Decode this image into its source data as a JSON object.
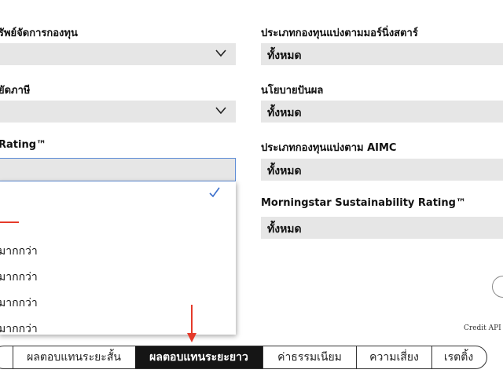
{
  "filters": {
    "left": {
      "fund_company_label": "รัพย์จัดการกองทุน",
      "tax_label": "ยัดภาษี",
      "rating_label": "Rating™"
    },
    "right": {
      "morningstar_category_label": "ประเภทกองทุนแบ่งตามมอร์นิ่งสตาร์",
      "morningstar_category_value": "ทั้งหมด",
      "dividend_policy_label": "นโยบายปันผล",
      "dividend_policy_value": "ทั้งหมด",
      "aimc_category_label": "ประเภทกองทุนแบ่งตาม AIMC",
      "aimc_category_value": "ทั้งหมด",
      "sustainability_label": "Morningstar Sustainability Rating™",
      "sustainability_value": "ทั้งหมด"
    }
  },
  "rating_dropdown": {
    "options": [
      "มากกว่า",
      "มากกว่า",
      "มากกว่า",
      "มากกว่า"
    ],
    "selected_index": 0
  },
  "credit": "Credit API K",
  "tabs": [
    {
      "label": "ผลตอบแทนระยะสั้น",
      "active": false
    },
    {
      "label": "ผลตอบแทนระยะยาว",
      "active": true
    },
    {
      "label": "ค่าธรรมเนียม",
      "active": false
    },
    {
      "label": "ความเสี่ยง",
      "active": false
    },
    {
      "label": "เรตติ้ง",
      "active": false
    }
  ],
  "colors": {
    "accent_red": "#e53a2a",
    "focus_blue": "#5b8bd6",
    "active_tab_bg": "#151515",
    "select_bg": "#e6e6e6"
  },
  "icons": {
    "select_arrow": "chevron-down-icon",
    "selected_mark": "check-icon",
    "annotation": "arrow-down-icon"
  }
}
